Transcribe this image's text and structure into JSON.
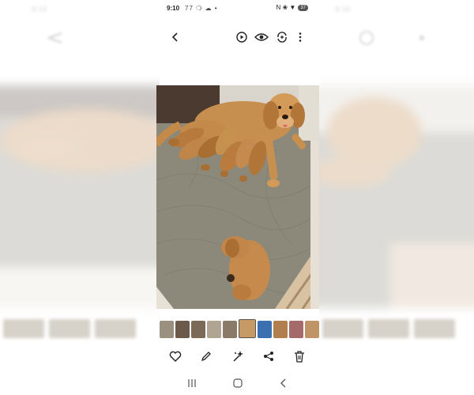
{
  "status_bar": {
    "time": "9:10",
    "notifications": "77 ❍ ☁ •",
    "system_icons": "N ❀ ▼",
    "battery": "37"
  },
  "top_bar": {
    "back_icon": "chevron-left-icon",
    "icons": [
      "motion-photo-icon",
      "eye-icon",
      "remaster-icon",
      "more-vertical-icon"
    ]
  },
  "photo": {
    "subject": "golden retriever nursing puppies",
    "colors": {
      "fur": "#c78f4f",
      "fur_dark": "#a86e32",
      "blanket": "#8d8a7c",
      "wall": "#4a3a30"
    }
  },
  "filmstrip": {
    "thumbnail_colors": [
      "#9b8f80",
      "#6b5a4c",
      "#7c6a58",
      "#b0a592",
      "#8a7b69",
      "#c59a65",
      "#3a6fb0",
      "#b07f4d",
      "#a46b6a",
      "#c19468",
      "#d8c7b4"
    ],
    "selected_index": 5
  },
  "bottom_actions": {
    "icons": [
      "heart-icon",
      "edit-pencil-icon",
      "ai-effects-icon",
      "share-icon",
      "delete-trash-icon"
    ]
  },
  "nav_bar": {
    "icons": [
      "recent-apps-icon",
      "home-icon",
      "back-nav-icon"
    ]
  },
  "colors": {
    "icon": "#222222",
    "background": "#ffffff",
    "battery_bg": "#555555"
  }
}
